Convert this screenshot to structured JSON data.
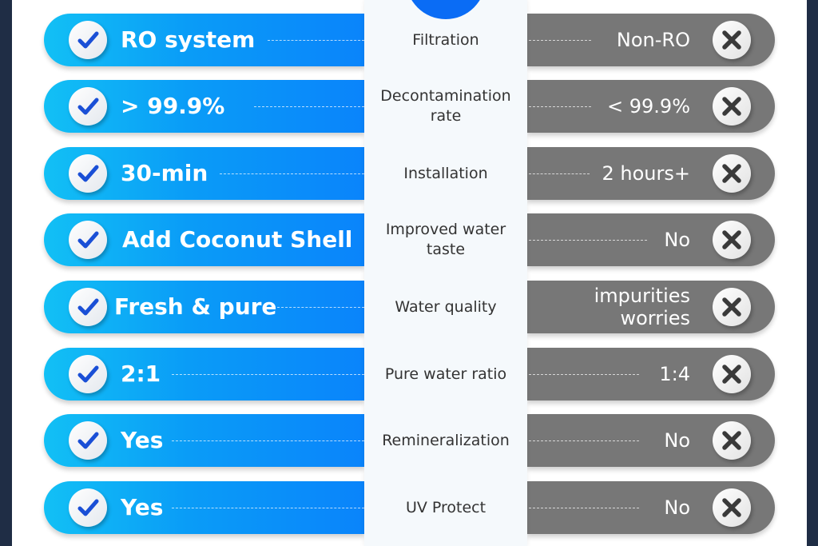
{
  "colors": {
    "accent_blue": "#0a84fb",
    "accent_cyan": "#12c0f5",
    "competitor_gray": "#777777",
    "frame": "#1f2d45",
    "check_color": "#1a4fd6",
    "x_color": "#3a3a3a"
  },
  "icons": {
    "ours": "check-icon",
    "theirs": "x-icon"
  },
  "rows": [
    {
      "feature": "Filtration",
      "ours": "RO system",
      "theirs": "Non-RO"
    },
    {
      "feature": "Decontamination\nrate",
      "ours": "> 99.9%",
      "theirs": "< 99.9%"
    },
    {
      "feature": "Installation",
      "ours": "30-min",
      "theirs": "2 hours+"
    },
    {
      "feature": "Improved water\ntaste",
      "ours": "Add Coconut Shell",
      "theirs": "No"
    },
    {
      "feature": "Water quality",
      "ours": "Fresh & pure",
      "theirs": "impurities\nworries"
    },
    {
      "feature": "Pure water ratio",
      "ours": "2:1",
      "theirs": "1:4"
    },
    {
      "feature": "Remineralization",
      "ours": "Yes",
      "theirs": "No"
    },
    {
      "feature": "UV Protect",
      "ours": "Yes",
      "theirs": "No"
    }
  ]
}
